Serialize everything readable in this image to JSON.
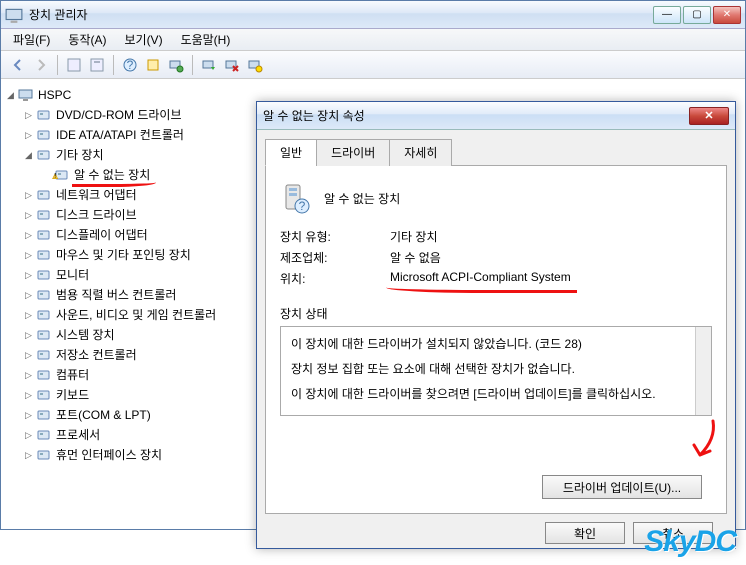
{
  "window": {
    "title": "장치 관리자",
    "menu": {
      "file": "파일(F)",
      "action": "동작(A)",
      "view": "보기(V)",
      "help": "도움말(H)"
    }
  },
  "tree": {
    "root": "HSPC",
    "items": [
      {
        "label": "DVD/CD-ROM 드라이브",
        "exp": "▷"
      },
      {
        "label": "IDE ATA/ATAPI 컨트롤러",
        "exp": "▷"
      },
      {
        "label": "기타 장치",
        "exp": "◢",
        "children": [
          {
            "label": "알 수 없는 장치",
            "warn": true,
            "hl": true
          }
        ]
      },
      {
        "label": "네트워크 어댑터",
        "exp": "▷"
      },
      {
        "label": "디스크 드라이브",
        "exp": "▷"
      },
      {
        "label": "디스플레이 어댑터",
        "exp": "▷"
      },
      {
        "label": "마우스 및 기타 포인팅 장치",
        "exp": "▷"
      },
      {
        "label": "모니터",
        "exp": "▷"
      },
      {
        "label": "범용 직렬 버스 컨트롤러",
        "exp": "▷"
      },
      {
        "label": "사운드, 비디오 및 게임 컨트롤러",
        "exp": "▷"
      },
      {
        "label": "시스템 장치",
        "exp": "▷"
      },
      {
        "label": "저장소 컨트롤러",
        "exp": "▷"
      },
      {
        "label": "컴퓨터",
        "exp": "▷"
      },
      {
        "label": "키보드",
        "exp": "▷"
      },
      {
        "label": "포트(COM & LPT)",
        "exp": "▷"
      },
      {
        "label": "프로세서",
        "exp": "▷"
      },
      {
        "label": "휴먼 인터페이스 장치",
        "exp": "▷"
      }
    ]
  },
  "dialog": {
    "title": "알 수 없는 장치 속성",
    "tabs": {
      "general": "일반",
      "driver": "드라이버",
      "details": "자세히"
    },
    "device_name": "알 수 없는 장치",
    "rows": {
      "type_k": "장치 유형:",
      "type_v": "기타 장치",
      "mfg_k": "제조업체:",
      "mfg_v": "알 수 없음",
      "loc_k": "위치:",
      "loc_v": "Microsoft ACPI-Compliant System"
    },
    "status_label": "장치 상태",
    "status_lines": [
      "이 장치에 대한 드라이버가 설치되지 않았습니다. (코드 28)",
      "장치 정보 집합 또는 요소에 대해 선택한 장치가 없습니다.",
      "이 장치에 대한 드라이버를 찾으려면 [드라이버 업데이트]를 클릭하십시오."
    ],
    "update_btn": "드라이버 업데이트(U)...",
    "ok": "확인",
    "cancel": "취소"
  },
  "watermark": "SkyDC"
}
